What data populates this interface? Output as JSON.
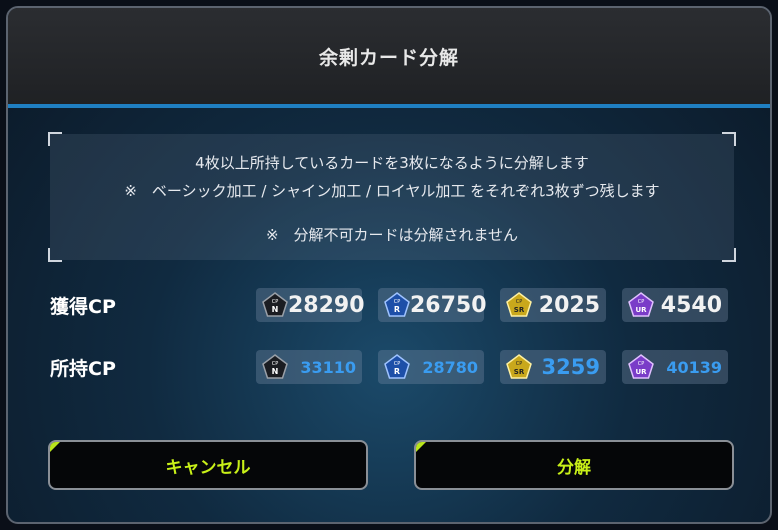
{
  "dialog": {
    "title": "余剰カード分解",
    "notice": {
      "line1": "4枚以上所持しているカードを3枚になるように分解します",
      "line2": "※　ベーシック加工 / シャイン加工 / ロイヤル加工 をそれぞれ3枚ずつ残します",
      "line3": "※　分解不可カードは分解されません"
    },
    "gain": {
      "label": "獲得CP",
      "items": [
        {
          "rarity": "N",
          "value": "28290",
          "color": "#1b1d22"
        },
        {
          "rarity": "R",
          "value": "26750",
          "color": "#1d4fa8"
        },
        {
          "rarity": "SR",
          "value": "2025",
          "color": "#c9a81c"
        },
        {
          "rarity": "UR",
          "value": "4540",
          "color": "#7a3cc8"
        }
      ]
    },
    "owned": {
      "label": "所持CP",
      "items": [
        {
          "rarity": "N",
          "value": "33110",
          "color": "#1b1d22"
        },
        {
          "rarity": "R",
          "value": "28780",
          "color": "#1d4fa8"
        },
        {
          "rarity": "SR",
          "value": "3259",
          "color": "#c9a81c"
        },
        {
          "rarity": "UR",
          "value": "40139",
          "color": "#7a3cc8"
        }
      ]
    },
    "buttons": {
      "cancel": "キャンセル",
      "confirm": "分解"
    },
    "accent": "#1f7fc2",
    "button_text_color": "#c8f018"
  }
}
